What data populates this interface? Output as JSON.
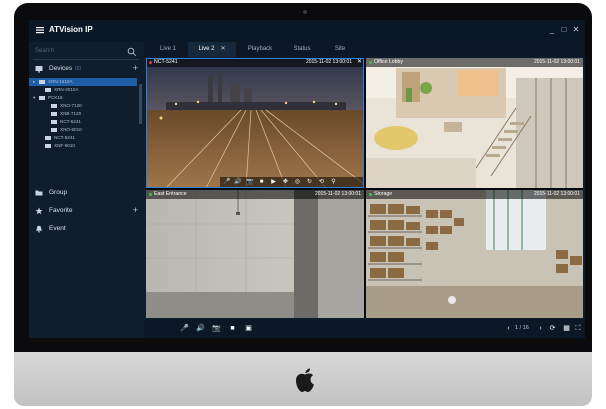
{
  "window": {
    "app_title": "ATVision IP",
    "minimize": "_",
    "maximize": "□",
    "close": "✕"
  },
  "sidebar": {
    "search_placeholder": "Search",
    "devices_label": "Devices",
    "devices_count": "00",
    "group_label": "Group",
    "favorite_label": "Favorite",
    "event_label": "Event",
    "tree": [
      {
        "label": "XRN-1610A",
        "selected": true,
        "level": 0,
        "arrow": "▸"
      },
      {
        "label": "XRN-2010A",
        "selected": false,
        "level": 1,
        "arrow": ""
      },
      {
        "label": "PCK16",
        "selected": false,
        "level": 0,
        "arrow": "▾"
      },
      {
        "label": "XNO-7120",
        "selected": false,
        "level": 2,
        "arrow": ""
      },
      {
        "label": "XNB-7120",
        "selected": false,
        "level": 2,
        "arrow": ""
      },
      {
        "label": "NCT-5241",
        "selected": false,
        "level": 2,
        "arrow": ""
      },
      {
        "label": "XNO-6010",
        "selected": false,
        "level": 2,
        "arrow": ""
      },
      {
        "label": "NCT-5241",
        "selected": false,
        "level": 1,
        "arrow": ""
      },
      {
        "label": "XNF-6010",
        "selected": false,
        "level": 1,
        "arrow": ""
      }
    ]
  },
  "tabs": [
    {
      "label": "Live 1",
      "active": false
    },
    {
      "label": "Live 2",
      "active": true,
      "close": "✕"
    },
    {
      "label": "Playback",
      "active": false
    },
    {
      "label": "Status",
      "active": false
    },
    {
      "label": "Site",
      "active": false
    }
  ],
  "cameras": [
    {
      "name": "NCT-5241",
      "timestamp": "2015-11-02 13:00:01",
      "close": "✕",
      "status": "recording",
      "status_color": "#e03c3c"
    },
    {
      "name": "Office Lobby",
      "timestamp": "2015-11-02 13:00:01",
      "status": "live",
      "status_color": "#3fbf4f"
    },
    {
      "name": "East Entrance",
      "timestamp": "2015-11-02 13:00:01",
      "status": "live",
      "status_color": "#3fbf4f"
    },
    {
      "name": "Storage",
      "timestamp": "2015-11-02 13:00:01",
      "status": "live",
      "status_color": "#3fbf4f"
    }
  ],
  "bottombar": {
    "page_indicator": "1 / 16"
  },
  "colors": {
    "accent": "#1e5ea8",
    "selection_border": "#2f7fd6",
    "app_bg": "#0f1e2e"
  }
}
